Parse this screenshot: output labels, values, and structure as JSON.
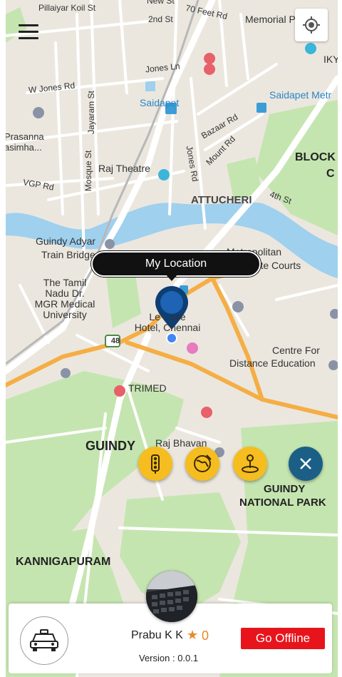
{
  "map": {
    "labels": {
      "pillaiyar_koil": "Pillaiyar Koil St",
      "new_st": "New St",
      "second_st": "2nd St",
      "seventy_feet": "70 Feet Rd",
      "memorial_pillar": "Memorial Pillar",
      "iky": "IKY",
      "jones_ln": "Jones Ln",
      "w_jones": "W Jones Rd",
      "jayaram": "Jayaram St",
      "saidapet": "Saidapet",
      "saidapet_metro": "Saidapet Metr",
      "bazaar": "Bazaar Rd",
      "mount_rd": "Mount Rd",
      "prasanna": "Prasanna\nasimha...",
      "mosque": "Mosque St",
      "raj_theatre": "Raj Theatre",
      "jones_rd": "Jones Rd",
      "block": "BLOCK",
      "block_c": "C",
      "vgp": "VGP Rd",
      "attucheri": "ATTUCHERI",
      "fourth_st": "4th St",
      "guindy_adyar": "Guindy Adyar",
      "train_bridge": "Train Bridge",
      "metropolitan": "Metropolitan",
      "courts": "...ate Courts",
      "tamil_nadu": "The Tamil\nNadu Dr.\nMGR Medical\nUniversity",
      "hotel": "Le ...ree\nHotel, Chennai",
      "nh48": "48",
      "centre": "Centre For",
      "distance": "Distance Education",
      "trimed": "TRIMED",
      "raj_bhavan": "Raj Bhavan",
      "guindy": "GUINDY",
      "guindy_park1": "GUINDY",
      "guindy_park2": "NATIONAL PARK",
      "kannigapuram": "KANNIGAPURAM"
    }
  },
  "my_location_label": "My Location",
  "driver": {
    "name": "Prabu K K",
    "rating": "0",
    "version": "Version : 0.0.1"
  },
  "actions": {
    "go_offline": "Go Offline"
  },
  "colors": {
    "map_bg": "#ebe7df",
    "park": "#c5e5b0",
    "water": "#9fd0ee",
    "arterial": "#f5ae45",
    "fab_yellow": "#f5bd1f",
    "close_fab": "#1b5f86",
    "offline_red": "#e8141c",
    "rating_orange": "#e8892a"
  },
  "icons": [
    "menu-icon",
    "gps-locate-icon",
    "location-pin-icon",
    "traffic-light-icon",
    "globe-icon",
    "map-pin-person-icon",
    "close-icon",
    "taxi-icon",
    "star-icon"
  ]
}
